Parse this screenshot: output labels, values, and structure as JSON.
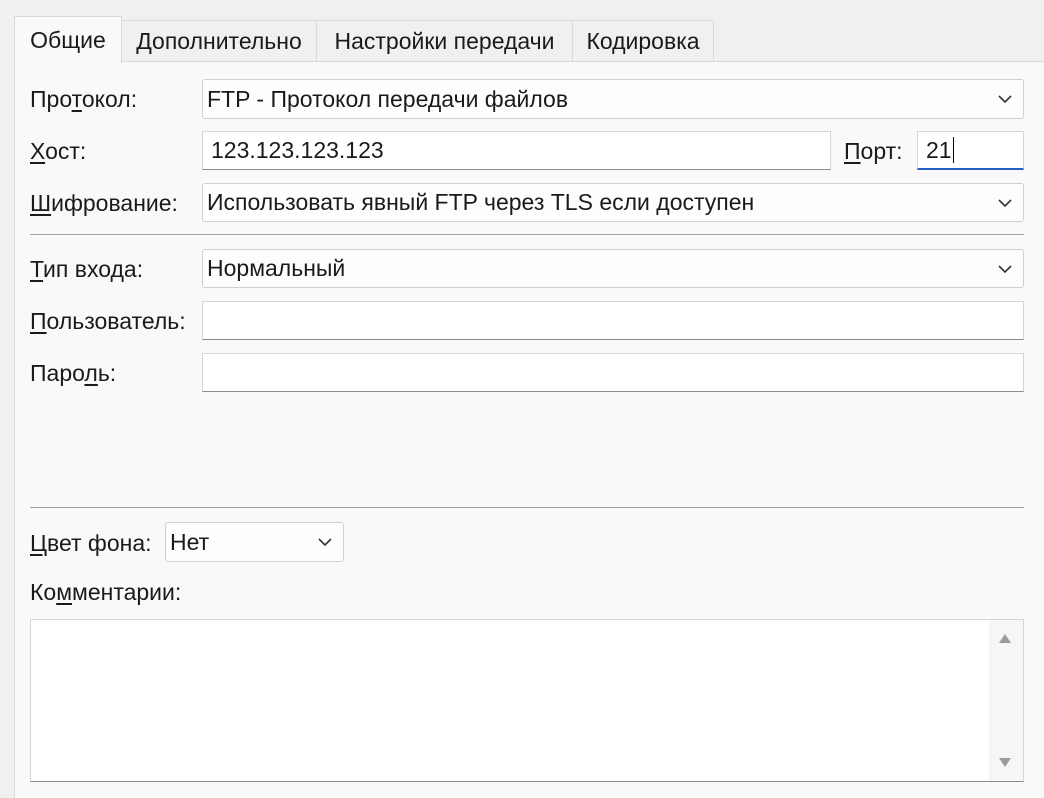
{
  "tabs": [
    {
      "label": "Общие",
      "active": true
    },
    {
      "label": "Дополнительно",
      "active": false
    },
    {
      "label": "Настройки передачи",
      "active": false
    },
    {
      "label": "Кодировка",
      "active": false
    }
  ],
  "protocol": {
    "label_pre": "Про",
    "label_u": "т",
    "label_post": "окол:",
    "value": "FTP - Протокол передачи файлов",
    "icon": "chevron-down-icon"
  },
  "host": {
    "label_u": "Х",
    "label_post": "ост:",
    "value": "123.123.123.123"
  },
  "port": {
    "label_u": "П",
    "label_post": "орт:",
    "value": "21"
  },
  "encryption": {
    "label_u": "Ш",
    "label_post": "ифрование:",
    "value": "Использовать явный FTP через TLS если доступен",
    "icon": "chevron-down-icon"
  },
  "logon_type": {
    "label_u": "Т",
    "label_post": "ип входа:",
    "value": "Нормальный",
    "icon": "chevron-down-icon"
  },
  "user": {
    "label_u": "П",
    "label_post": "ользователь:",
    "value": ""
  },
  "password": {
    "label_pre": "Паро",
    "label_u": "л",
    "label_post": "ь:",
    "value": ""
  },
  "background_color": {
    "label_u": "Ц",
    "label_post": "вет фона:",
    "value": "Нет",
    "icon": "chevron-down-icon"
  },
  "comments": {
    "label_pre": "Ко",
    "label_u": "м",
    "label_post": "ментарии:",
    "value": ""
  },
  "colors": {
    "panel_bg": "#f9f9f9",
    "window_bg": "#f0f0f0",
    "focus_accent": "#2a5ec4"
  }
}
